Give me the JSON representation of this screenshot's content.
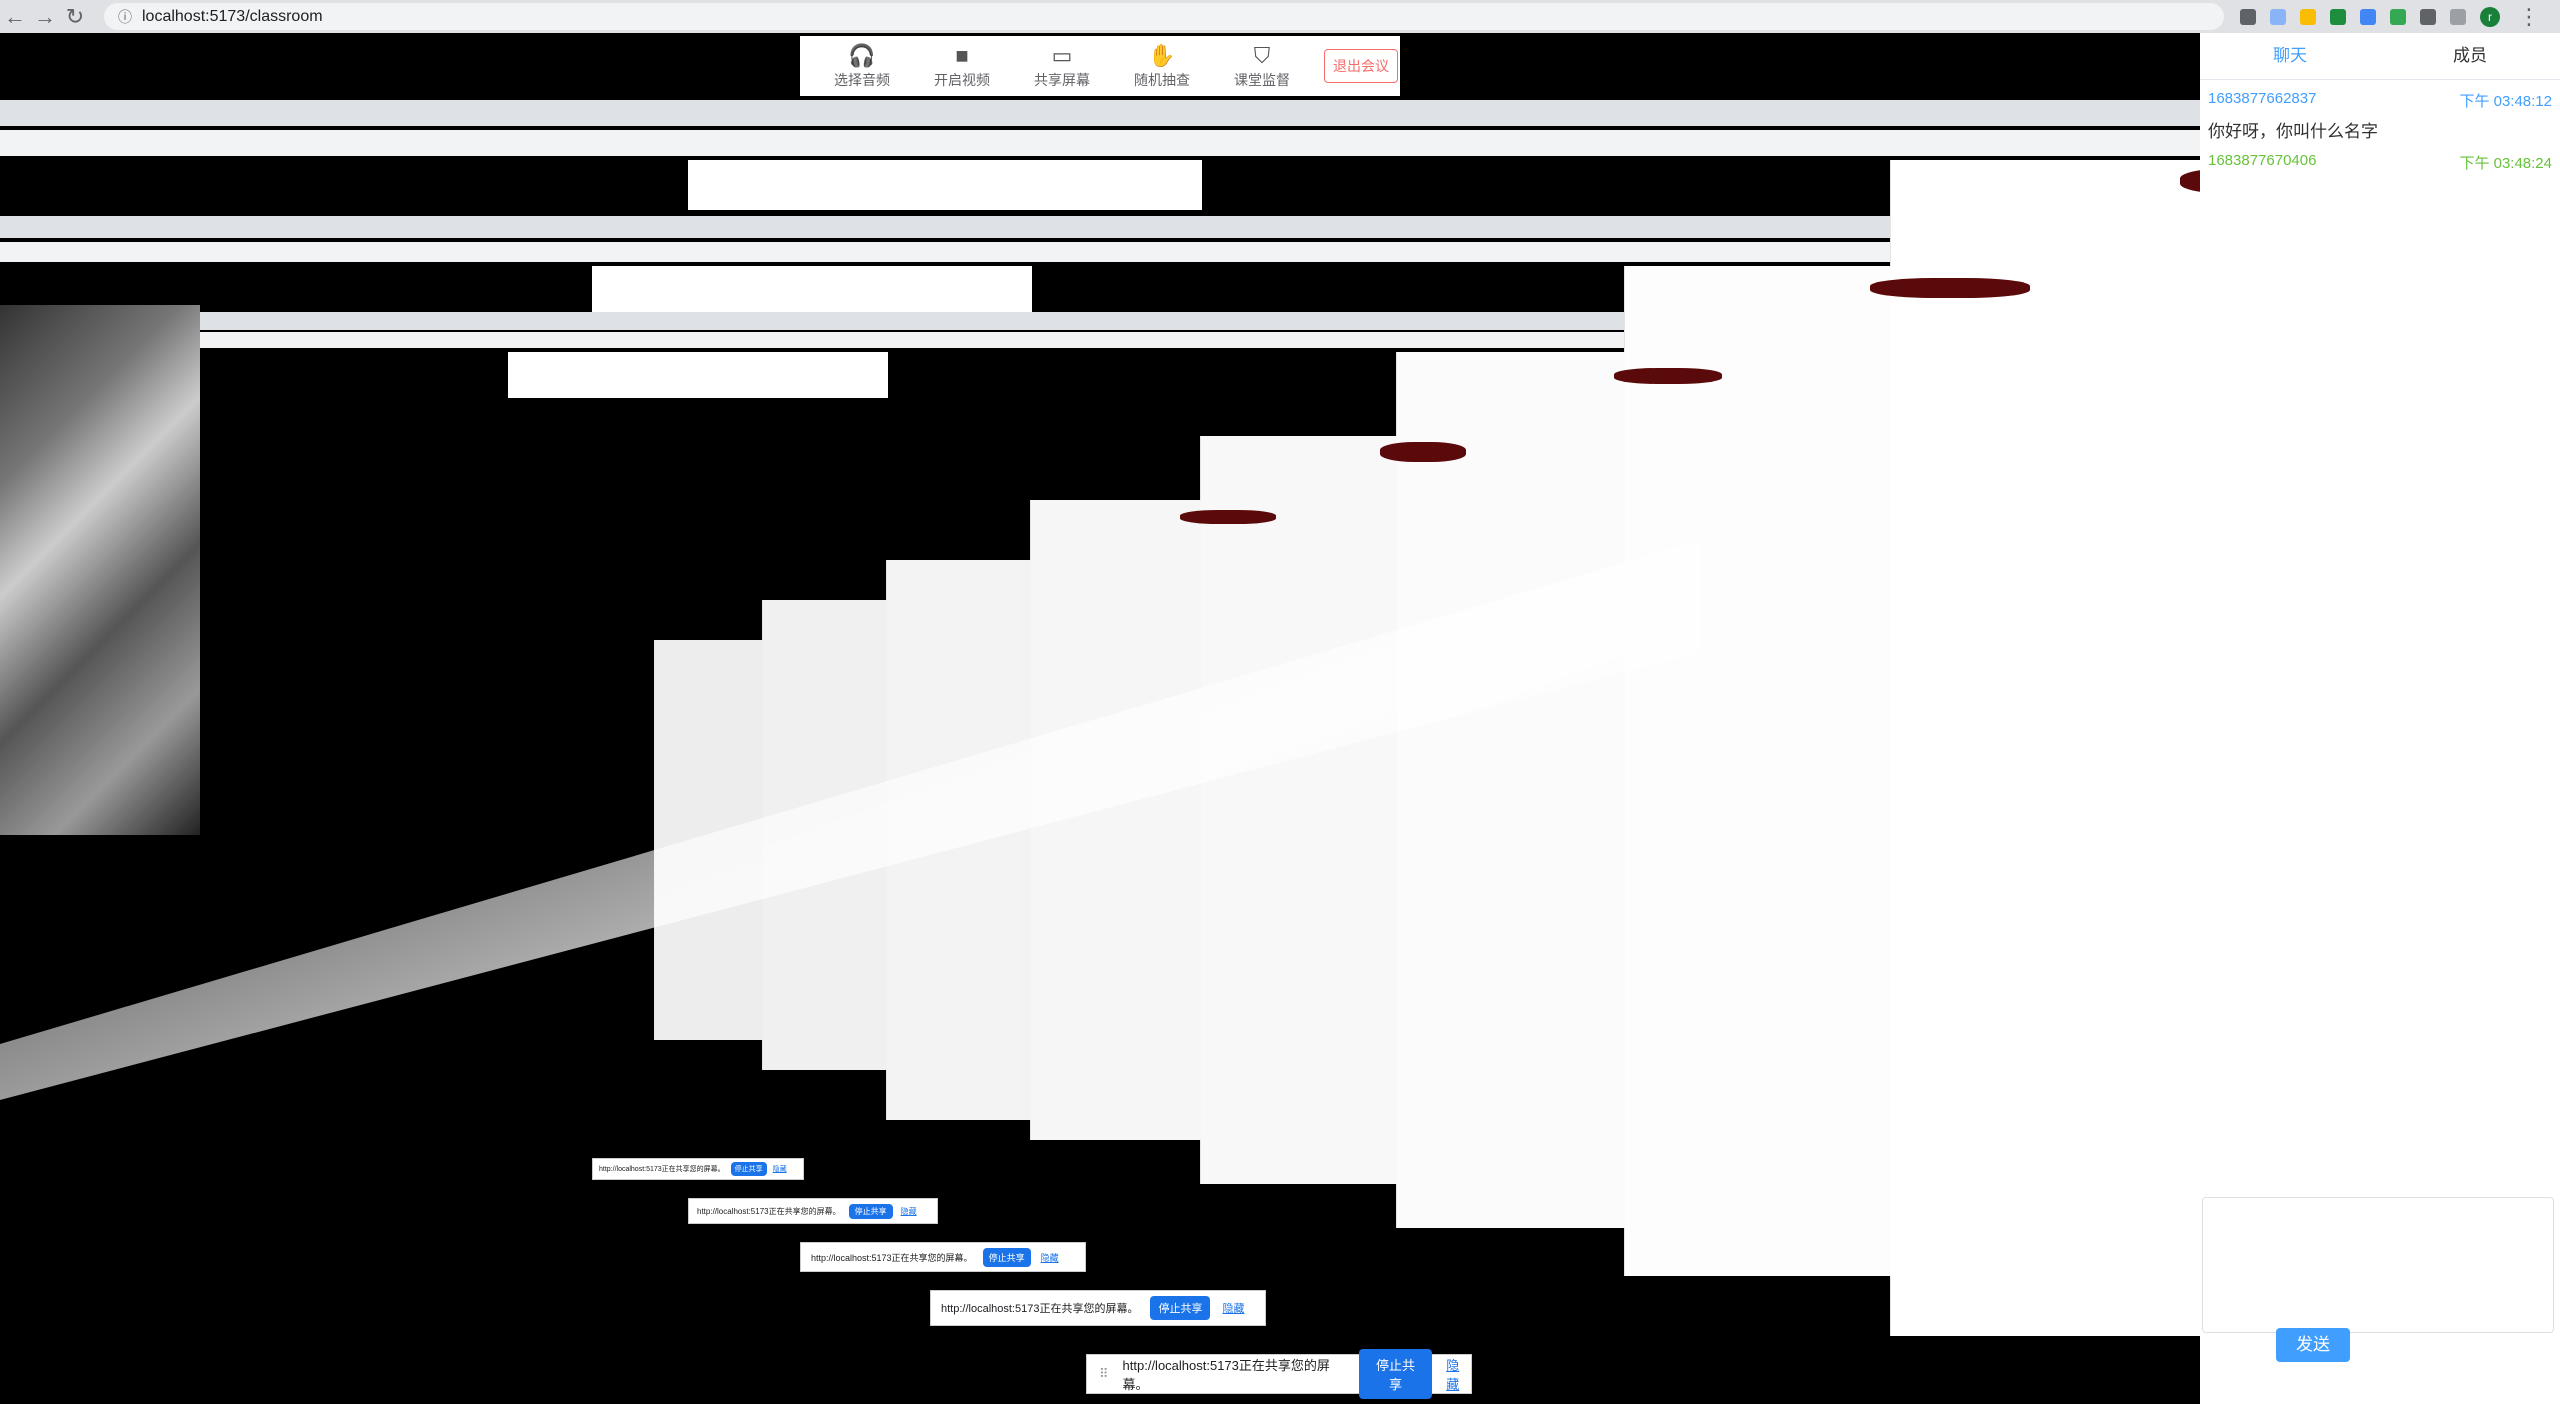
{
  "browser": {
    "url": "localhost:5173/classroom",
    "nav": {
      "back_icon": "arrow-left-icon",
      "forward_icon": "arrow-right-icon",
      "reload_icon": "reload-icon"
    }
  },
  "toolbar": {
    "buttons": [
      {
        "label": "选择音频",
        "icon": "headphones-icon"
      },
      {
        "label": "开启视频",
        "icon": "video-camera-icon"
      },
      {
        "label": "共享屏幕",
        "icon": "monitor-icon"
      },
      {
        "label": "随机抽查",
        "icon": "hand-icon"
      },
      {
        "label": "课堂监督",
        "icon": "shield-icon"
      }
    ],
    "leave_label": "退出会议"
  },
  "chat": {
    "tabs": [
      {
        "label": "聊天",
        "active": true
      },
      {
        "label": "成员",
        "active": false
      }
    ],
    "messages": [
      {
        "user": "1683877662837",
        "time": "下午 03:48:12",
        "text": "你好呀，你叫什么名字",
        "color": "#409eff"
      },
      {
        "user": "1683877670406",
        "time": "下午 03:48:24",
        "text": "",
        "color": "#67c23a"
      }
    ],
    "send_label": "发送"
  },
  "share_bar": {
    "text": "http://localhost:5173正在共享您的屏幕。",
    "stop_label": "停止共享",
    "hide_label": "隐藏"
  },
  "colors": {
    "accent": "#409eff",
    "danger": "#f56c6c",
    "chrome_blue": "#1a73e8",
    "green": "#67c23a"
  }
}
